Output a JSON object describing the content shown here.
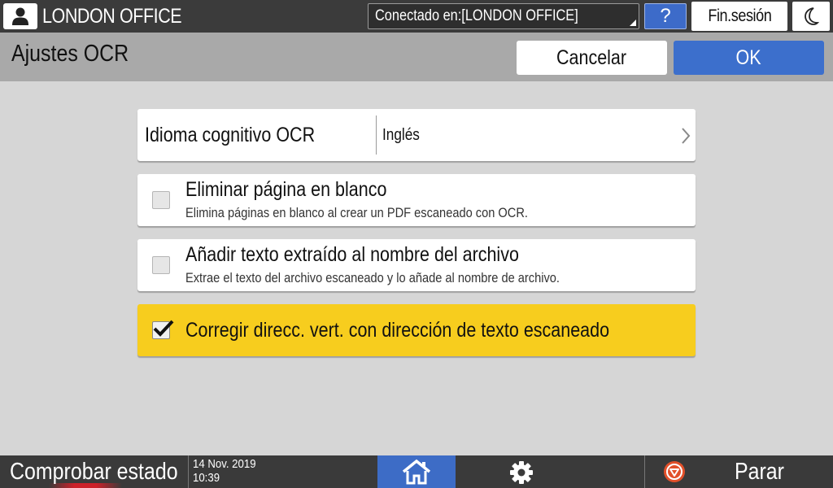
{
  "header": {
    "office_name": "LONDON OFFICE",
    "connection": "Conectado en:[LONDON OFFICE]",
    "help_label": "?",
    "logout_label": "Fin.sesión"
  },
  "titlebar": {
    "title": "Ajustes OCR",
    "cancel_label": "Cancelar",
    "ok_label": "OK"
  },
  "settings": {
    "language": {
      "label": "Idioma cognitivo OCR",
      "value": "Inglés"
    },
    "options": [
      {
        "title": "Eliminar página en blanco",
        "description": "Elimina páginas en blanco al crear un PDF escaneado con OCR.",
        "checked": false
      },
      {
        "title": "Añadir texto extraído al nombre del archivo",
        "description": "Extrae el texto del archivo escaneado y lo añade al nombre de archivo.",
        "checked": false
      },
      {
        "title": "Corregir direcc. vert. con dirección de texto escaneado",
        "checked": true
      }
    ]
  },
  "footer": {
    "status_label": "Comprobar estado",
    "date": "14 Nov. 2019",
    "time": "10:39",
    "stop_label": "Parar"
  },
  "colors": {
    "accent_blue": "#3d6cc6",
    "highlight_yellow": "#f7cd1e",
    "panel_gray": "#d6d6d6"
  },
  "icons": [
    "user-icon",
    "moon-icon",
    "chevron-right-icon",
    "checkmark-icon",
    "home-icon",
    "gear-icon",
    "stop-icon"
  ]
}
